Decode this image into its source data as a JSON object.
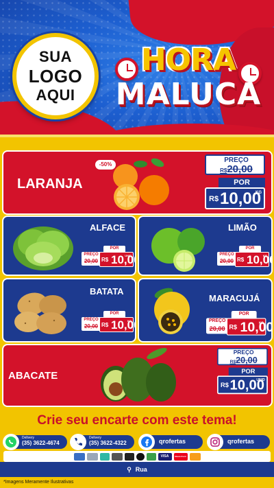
{
  "header": {
    "logo_lines": [
      "SUA",
      "LOGO",
      "AQUI"
    ],
    "title_line1": "HORA",
    "title_line2": "MALUCA"
  },
  "products": {
    "laranja": {
      "name": "LARANJA",
      "discount": "-50%",
      "preco_label": "PREÇO",
      "old_currency": "R$",
      "old_price": "20,00",
      "por_label": "POR",
      "currency": "R$",
      "price": "10,00",
      "unit": "KG"
    },
    "alface": {
      "name": "ALFACE",
      "preco_label": "PREÇO",
      "old_price": "20,00",
      "por_label": "POR",
      "currency": "R$",
      "price": "10,00",
      "unit": "UNID"
    },
    "limao": {
      "name": "LIMÃO",
      "preco_label": "PREÇO",
      "old_price": "20,00",
      "por_label": "POR",
      "currency": "R$",
      "price": "10,00",
      "unit": "KG"
    },
    "batata": {
      "name": "BATATA",
      "preco_label": "PREÇO",
      "old_price": "20,00",
      "por_label": "POR",
      "currency": "R$",
      "price": "10,00",
      "unit": "KG"
    },
    "maracuja": {
      "name": "MARACUJÁ",
      "preco_label": "PREÇO",
      "old_price": "20,00",
      "por_label": "POR",
      "currency": "R$",
      "price": "10,00",
      "unit": "KG"
    },
    "abacate": {
      "name": "ABACATE",
      "preco_label": "PREÇO",
      "old_currency": "R$",
      "old_price": "20,00",
      "por_label": "POR",
      "currency": "R$",
      "price": "10,00",
      "unit": "UNID"
    }
  },
  "footer": {
    "cta": "Crie seu encarte com este tema!",
    "contacts": [
      {
        "label": "Delivery",
        "value": "(35) 3622-4674",
        "icon": "whatsapp-icon"
      },
      {
        "label": "Delivery",
        "value": "(35) 3622-4322",
        "icon": "phone-icon"
      },
      {
        "value": "qrofertas",
        "icon": "facebook-icon"
      },
      {
        "value": "qrofertas",
        "icon": "instagram-icon"
      }
    ],
    "payments": [
      "VISA",
      "MasterCard"
    ],
    "address": "Rua",
    "disclaimer": "*Imagens Meramente Ilustrativas"
  },
  "colors": {
    "red": "#d3122a",
    "blue": "#1d3a8f",
    "yellow": "#f2c400"
  }
}
